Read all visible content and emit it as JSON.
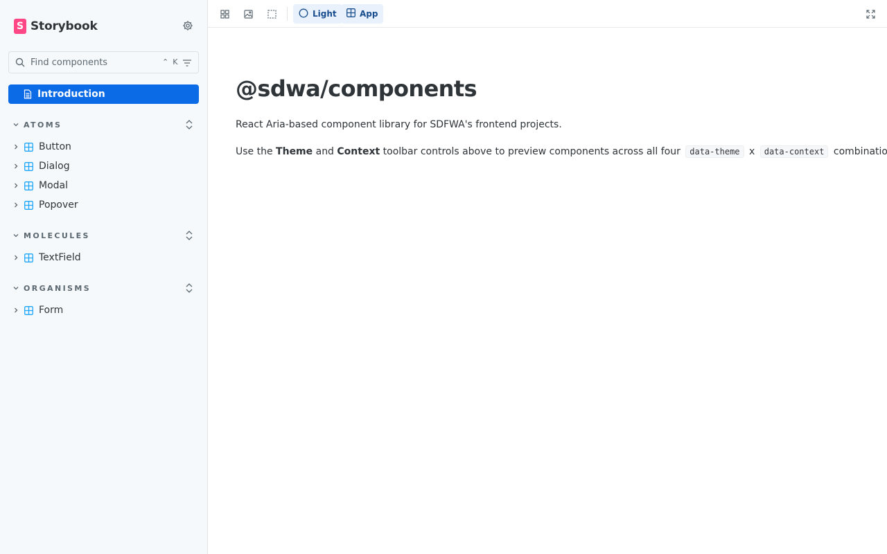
{
  "sidebar": {
    "brand": {
      "logo_letter": "S",
      "name": "Storybook"
    },
    "search": {
      "placeholder": "Find components",
      "shortcut_mod": "⌃",
      "shortcut_key": "K"
    },
    "introduction": {
      "label": "Introduction"
    },
    "groups": [
      {
        "title": "ATOMS",
        "items": [
          "Button",
          "Dialog",
          "Modal",
          "Popover"
        ]
      },
      {
        "title": "MOLECULES",
        "items": [
          "TextField"
        ]
      },
      {
        "title": "ORGANISMS",
        "items": [
          "Form"
        ]
      }
    ]
  },
  "toolbar": {
    "theme_label": "Light",
    "context_label": "App"
  },
  "content": {
    "title": "@sdwa/components",
    "intro": "React Aria-based component library for SDFWA's frontend projects.",
    "usage": {
      "prefix": "Use the",
      "theme_word": "Theme",
      "and": "and",
      "context_word": "Context",
      "middle": "toolbar controls above to preview components across all four",
      "code1": "data-theme",
      "times": "x",
      "code2": "data-context",
      "suffix": "combinations."
    }
  },
  "colors": {
    "accent": "#0b6be6",
    "brand": "#ff4785",
    "component_icon": "#1ea7fd"
  }
}
